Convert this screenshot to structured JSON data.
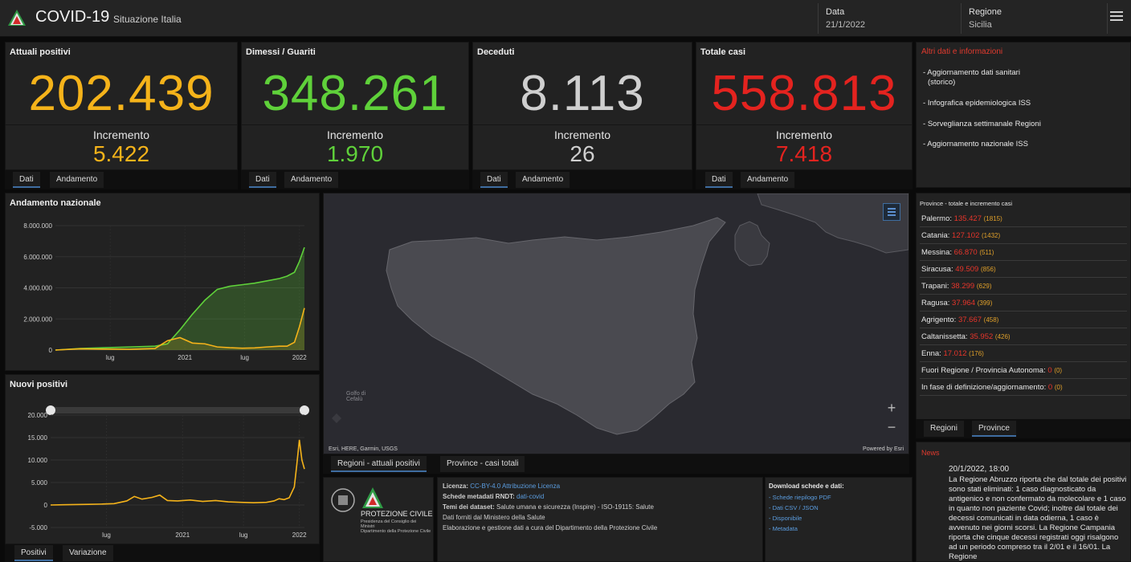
{
  "header": {
    "title": "COVID-19",
    "subtitle": "Situazione Italia",
    "date_label": "Data",
    "date_value": "21/1/2022",
    "region_label": "Regione",
    "region_value": "Sicilia"
  },
  "kpis": [
    {
      "label": "Attuali positivi",
      "value": "202.439",
      "inc_label": "Incremento",
      "inc": "5.422",
      "color": "#f5b31a",
      "tabs": [
        "Dati",
        "Andamento"
      ]
    },
    {
      "label": "Dimessi / Guariti",
      "value": "348.261",
      "inc_label": "Incremento",
      "inc": "1.970",
      "color": "#5fd13a",
      "tabs": [
        "Dati",
        "Andamento"
      ]
    },
    {
      "label": "Deceduti",
      "value": "8.113",
      "inc_label": "Incremento",
      "inc": "26",
      "color": "#cfcfcf",
      "tabs": [
        "Dati",
        "Andamento"
      ]
    },
    {
      "label": "Totale casi",
      "value": "558.813",
      "inc_label": "Incremento",
      "inc": "7.418",
      "color": "#e4231f",
      "tabs": [
        "Dati",
        "Andamento"
      ]
    }
  ],
  "info": {
    "title": "Altri dati e informazioni",
    "links": [
      "Aggiornamento dati sanitari",
      "(storico)",
      "Infografica epidemiologica ISS",
      "Sorveglianza settimanale Regioni",
      "Aggiornamento nazionale ISS"
    ]
  },
  "provinces": {
    "title": "Province - totale e incremento casi",
    "rows": [
      {
        "name": "Palermo:",
        "value": "135.427",
        "delta": "(1815)"
      },
      {
        "name": "Catania:",
        "value": "127.102",
        "delta": "(1432)"
      },
      {
        "name": "Messina:",
        "value": "66.870",
        "delta": "(511)"
      },
      {
        "name": "Siracusa:",
        "value": "49.509",
        "delta": "(856)"
      },
      {
        "name": "Trapani:",
        "value": "38.299",
        "delta": "(629)"
      },
      {
        "name": "Ragusa:",
        "value": "37.964",
        "delta": "(399)"
      },
      {
        "name": "Agrigento:",
        "value": "37.667",
        "delta": "(458)"
      },
      {
        "name": "Caltanissetta:",
        "value": "35.952",
        "delta": "(426)"
      },
      {
        "name": "Enna:",
        "value": "17.012",
        "delta": "(176)"
      },
      {
        "name": "Fuori Regione / Provincia Autonoma:",
        "value": "0",
        "delta": "(0)"
      },
      {
        "name": "In fase di definizione/aggiornamento:",
        "value": "0",
        "delta": "(0)"
      }
    ],
    "tabs": [
      "Regioni",
      "Province"
    ]
  },
  "news": {
    "title": "News",
    "date": "20/1/2022, 18:00",
    "body": "La Regione Abruzzo riporta che dal totale dei positivi sono stati eliminati: 1 caso diagnosticato da antigenico e non confermato da molecolare e 1 caso in quanto non paziente Covid; inoltre dal totale dei decessi comunicati in data odierna, 1 caso è avvenuto nei giorni scorsi. La Regione Campania riporta che cinque decessi registrati oggi risalgono ad un periodo compreso tra il 2/01 e il 16/01. La Regione"
  },
  "map": {
    "attribution": "Esri, HERE, Garmin, USGS",
    "powered": "Powered by Esri",
    "sea_label": "Golfo di Cefalù",
    "tabs": [
      "Regioni - attuali positivi",
      "Province - casi totali"
    ],
    "zoom_in": "+",
    "zoom_out": "−"
  },
  "footer": {
    "org": "PROTEZIONE CIVILE",
    "org_sub": "Presidenza del Consiglio dei Ministri\nDipartimento della Protezione Civile",
    "license_label": "Licenza:",
    "license_value": "CC-BY-4.0 Attribuzione Licenza",
    "meta_label": "Schede metadati RNDT:",
    "meta_value": "dati-covid",
    "themes_label": "Temi dei dataset:",
    "themes_value": "Salute umana e sicurezza (Inspire) - ISO-19115: Salute",
    "source": "Dati forniti dal Ministero della Salute",
    "elaboration": "Elaborazione e gestione dati a cura del Dipartimento della Protezione Civile",
    "downloads_title": "Download schede e dati:",
    "downloads": [
      "Schede riepilogo PDF",
      "Dati CSV / JSON",
      "Disponibile",
      "Metadata"
    ]
  },
  "colors": {
    "positivi": "#f5b31a",
    "guariti": "#5fd13a",
    "deceduti": "#cfcfcf",
    "totale": "#e4231f",
    "accent": "#3f6da0"
  },
  "chart_data": [
    {
      "type": "area",
      "title": "Andamento nazionale",
      "x_ticks": [
        "lug",
        "2021",
        "lug",
        "2022"
      ],
      "y_ticks": [
        "0",
        "2.000.000",
        "4.000.000",
        "6.000.000",
        "8.000.000"
      ],
      "ylim": [
        0,
        8000000
      ],
      "x": [
        0,
        0.1,
        0.2,
        0.3,
        0.4,
        0.45,
        0.5,
        0.55,
        0.6,
        0.65,
        0.7,
        0.75,
        0.8,
        0.85,
        0.9,
        0.93,
        0.96,
        0.98,
        1.0
      ],
      "series": [
        {
          "name": "",
          "color": "#5fd13a",
          "values": [
            0,
            100000,
            150000,
            200000,
            250000,
            400000,
            1300000,
            2300000,
            3200000,
            3900000,
            4100000,
            4200000,
            4300000,
            4450000,
            4600000,
            4750000,
            5000000,
            5700000,
            6600000
          ]
        },
        {
          "name": "",
          "color": "#f5b31a",
          "values": [
            0,
            80000,
            60000,
            50000,
            100000,
            600000,
            800000,
            450000,
            400000,
            200000,
            150000,
            120000,
            140000,
            200000,
            250000,
            250000,
            500000,
            1500000,
            2700000
          ]
        }
      ]
    },
    {
      "type": "line",
      "title": "Nuovi positivi",
      "x_ticks": [
        "lug",
        "2021",
        "lug",
        "2022"
      ],
      "y_ticks": [
        "-5.000",
        "0",
        "5.000",
        "10.000",
        "15.000",
        "20.000"
      ],
      "ylim": [
        -5000,
        20000
      ],
      "x": [
        0,
        0.05,
        0.1,
        0.15,
        0.2,
        0.25,
        0.3,
        0.33,
        0.36,
        0.4,
        0.43,
        0.46,
        0.5,
        0.55,
        0.6,
        0.65,
        0.7,
        0.75,
        0.8,
        0.85,
        0.88,
        0.9,
        0.92,
        0.94,
        0.96,
        0.97,
        0.98,
        0.99,
        1.0
      ],
      "series": [
        {
          "name": "",
          "color": "#f5b31a",
          "values": [
            0,
            50,
            100,
            150,
            200,
            300,
            900,
            1900,
            1300,
            1700,
            2200,
            1000,
            900,
            1100,
            800,
            1000,
            700,
            600,
            500,
            600,
            900,
            1400,
            1200,
            1600,
            4000,
            9000,
            14500,
            10000,
            8000
          ]
        }
      ],
      "tabs": [
        "Positivi",
        "Variazione"
      ]
    }
  ]
}
